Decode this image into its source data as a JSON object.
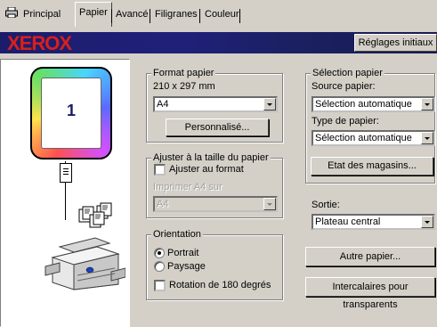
{
  "tabs": [
    {
      "label": "Principal"
    },
    {
      "label": "Papier"
    },
    {
      "label": "Avancé"
    },
    {
      "label": "Filigranes"
    },
    {
      "label": "Couleur"
    }
  ],
  "banner": {
    "logo": "XEROX",
    "reset_button": "Réglages initiaux"
  },
  "preview": {
    "page_number": "1"
  },
  "format": {
    "title": "Format papier",
    "dimensions": "210 x 297 mm",
    "size_value": "A4",
    "custom_button": "Personnalisé..."
  },
  "fit": {
    "title": "Ajuster à la taille du papier",
    "checkbox_label": "Ajuster au format",
    "print_on_label": "Imprimer A4 sur",
    "print_on_value": "A4"
  },
  "orientation": {
    "title": "Orientation",
    "portrait": "Portrait",
    "landscape": "Paysage",
    "rotate": "Rotation de 180 degrés",
    "selected": "portrait"
  },
  "selection": {
    "title": "Sélection papier",
    "source_label": "Source papier:",
    "source_value": "Sélection automatique",
    "type_label": "Type de papier:",
    "type_value": "Sélection automatique",
    "trays_button": "Etat des magasins..."
  },
  "output": {
    "label": "Sortie:",
    "value": "Plateau central",
    "other_paper_button": "Autre papier...",
    "inserts_button": "Intercalaires pour transparents"
  },
  "colors": {
    "banner": "#1c1c6c",
    "logo": "#d8201a",
    "face": "#d4d0c8"
  }
}
